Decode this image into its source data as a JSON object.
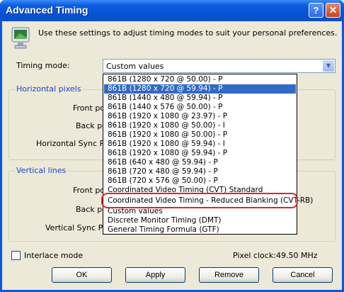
{
  "window": {
    "title": "Advanced Timing",
    "help_icon": "?",
    "close_icon": "✕"
  },
  "intro_text": "Use these settings to adjust timing modes to suit your personal preferences.",
  "timing_mode": {
    "label": "Timing mode:",
    "selected": "Custom values",
    "options": [
      "861B (1280 x 720 @ 50.00) - P",
      "861B (1280 x 720 @ 59.94) - P",
      "861B (1440 x 480 @ 59.94) - P",
      "861B (1440 x 576 @ 50.00) - P",
      "861B (1920 x 1080 @ 23.97) - P",
      "861B (1920 x 1080 @ 50.00) - I",
      "861B (1920 x 1080 @ 50.00) - P",
      "861B (1920 x 1080 @ 59.94) - I",
      "861B (1920 x 1080 @ 59.94) - P",
      "861B (640 x 480 @ 59.94) - P",
      "861B (720 x 480 @ 59.94) - P",
      "861B (720 x 576 @ 50.00) - P",
      "Coordinated Video Timing (CVT) Standard",
      "Coordinated Video Timing - Reduced Blanking (CVT-RB)",
      "Custom values",
      "Discrete Monitor Timing (DMT)",
      "General Timing Formula (GTF)"
    ],
    "highlighted_index": 1
  },
  "horizontal": {
    "title": "Horizontal pixels",
    "front_porch": "Front po",
    "back_porch": "Back po",
    "sync_polarity": "Horizontal Sync Pola"
  },
  "vertical": {
    "title": "Vertical lines",
    "front_porch": "Front po",
    "back_porch": "Back po",
    "sync_polarity": "Vertical Sync Pol"
  },
  "interlace": {
    "label": "Interlace mode",
    "checked": false
  },
  "pixel_clock": {
    "label": "Pixel clock:",
    "value": "49.50",
    "unit": "MHz"
  },
  "buttons": {
    "ok": "OK",
    "apply": "Apply",
    "remove": "Remove",
    "cancel": "Cancel"
  },
  "colors": {
    "titlebar": "#0a58e0",
    "selection": "#316ac5",
    "annotation": "#e32424",
    "group_title": "#1a44c8"
  }
}
